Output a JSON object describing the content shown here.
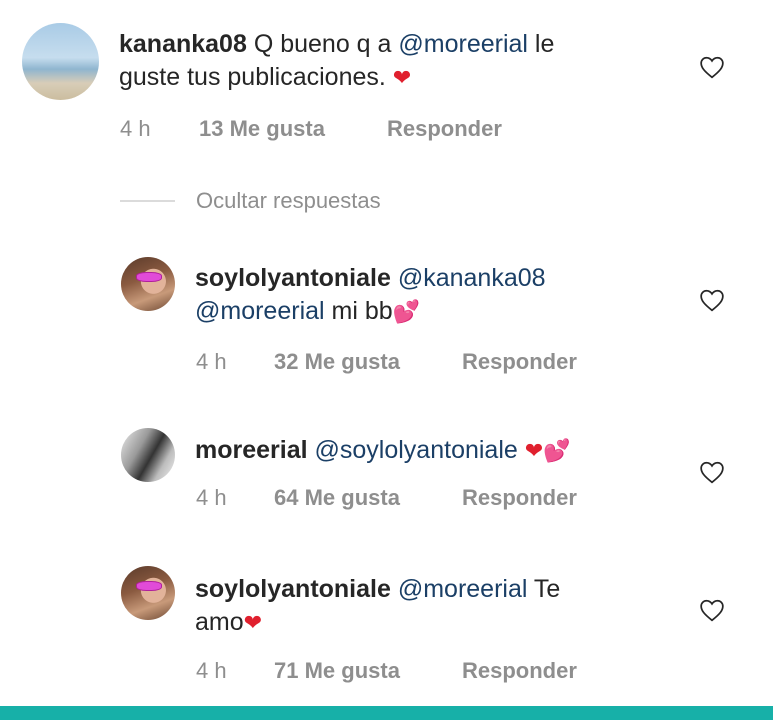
{
  "comments": [
    {
      "username": "kananka08",
      "text_before": " Q bueno q a ",
      "mention": "@moreerial",
      "text_after": " le",
      "text_line2": "guste tus publicaciones. ",
      "emoji": "❤",
      "time": "4 h",
      "likes": "13 Me gusta",
      "reply": "Responder",
      "avatar": "beach-photo"
    },
    {
      "username": "soylolyantoniale",
      "mention1": "@kananka08",
      "mention2": "@moreerial",
      "text": " mi bb",
      "emoji": "💕",
      "time": "4 h",
      "likes": "32 Me gusta",
      "reply": "Responder",
      "avatar": "selfie-photo"
    },
    {
      "username": "moreerial",
      "mention": "@soylolyantoniale",
      "emoji1": "❤",
      "emoji2": "💕",
      "time": "4 h",
      "likes": "64 Me gusta",
      "reply": "Responder",
      "avatar": "bw-photo"
    },
    {
      "username": "soylolyantoniale",
      "mention": "@moreerial",
      "text": " Te",
      "text_line2": "amo",
      "emoji": "❤",
      "time": "4 h",
      "likes": "71 Me gusta",
      "reply": "Responder",
      "avatar": "selfie-photo"
    }
  ],
  "hide_replies": "Ocultar respuestas",
  "icons": {
    "like": "heart-outline-icon"
  },
  "colors": {
    "mention": "#1b3f66",
    "meta": "#8e8e8e",
    "accent_bar": "#17b0a8"
  }
}
